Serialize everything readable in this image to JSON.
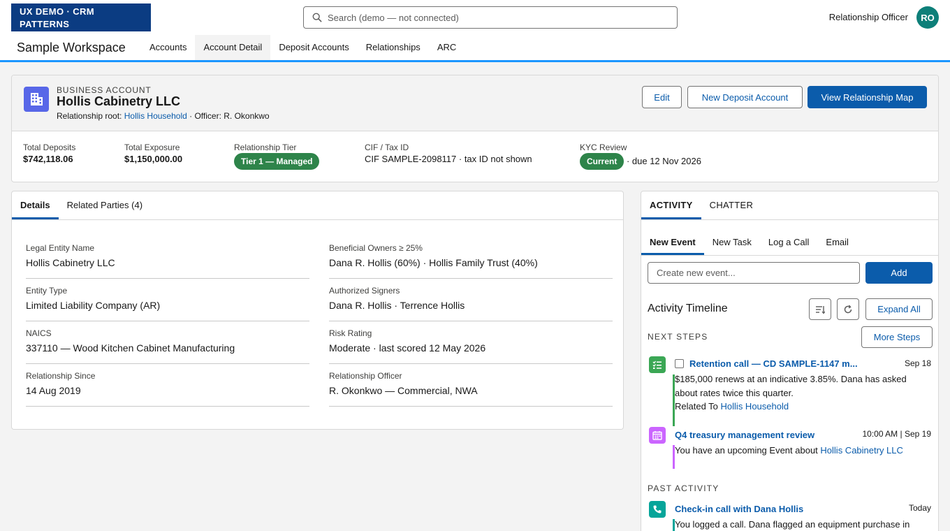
{
  "header": {
    "brand_line1": "UX DEMO · CRM",
    "brand_line2": "PATTERNS",
    "search_placeholder": "Search (demo — not connected)",
    "user_role": "Relationship Officer",
    "avatar_initials": "RO"
  },
  "nav": {
    "app_name": "Sample Workspace",
    "items": [
      {
        "label": "Accounts"
      },
      {
        "label": "Account Detail",
        "active": true
      },
      {
        "label": "Deposit Accounts"
      },
      {
        "label": "Relationships"
      },
      {
        "label": "ARC"
      }
    ]
  },
  "record": {
    "type": "BUSINESS ACCOUNT",
    "name": "Hollis Cabinetry LLC",
    "sub_prefix": "Relationship root: ",
    "sub_link": "Hollis Household",
    "sub_suffix": " · Officer: R. Okonkwo",
    "icon": "building-icon",
    "icon_color": "#5867e8",
    "actions": {
      "edit": "Edit",
      "new_deposit": "New Deposit Account",
      "view_map": "View Relationship Map"
    },
    "highlights": [
      {
        "label": "Total Deposits",
        "value": "$742,118.06"
      },
      {
        "label": "Total Exposure",
        "value": "$1,150,000.00"
      },
      {
        "label": "Relationship Tier",
        "value": "Tier 1 — Managed"
      },
      {
        "label": "CIF / Tax ID",
        "value": "CIF SAMPLE-2098117 · tax ID not shown"
      },
      {
        "label": "KYC Review",
        "value": "Current",
        "suffix": " · due 12 Nov 2026"
      }
    ],
    "status_color": "#2e844a"
  },
  "details": {
    "tabs": [
      {
        "label": "Details",
        "active": true
      },
      {
        "label": "Related Parties (4)"
      }
    ],
    "fields_left": [
      {
        "label": "Legal Entity Name",
        "value": "Hollis Cabinetry LLC"
      },
      {
        "label": "Entity Type",
        "value": "Limited Liability Company (AR)"
      },
      {
        "label": "NAICS",
        "value": "337110 — Wood Kitchen Cabinet Manufacturing"
      },
      {
        "label": "Relationship Since",
        "value": "14 Aug 2019"
      }
    ],
    "fields_right": [
      {
        "label": "Beneficial Owners ≥ 25%",
        "value": "Dana R. Hollis (60%) · Hollis Family Trust (40%)"
      },
      {
        "label": "Authorized Signers",
        "value": "Dana R. Hollis · Terrence Hollis"
      },
      {
        "label": "Risk Rating",
        "value": "Moderate · last scored 12 May 2026"
      },
      {
        "label": "Relationship Officer",
        "value": "R. Okonkwo — Commercial, NWA"
      }
    ]
  },
  "activity": {
    "tabs": [
      {
        "label": "ACTIVITY",
        "active": true
      },
      {
        "label": "CHATTER"
      }
    ],
    "sub_tabs": [
      {
        "label": "New Event",
        "active": true
      },
      {
        "label": "New Task"
      },
      {
        "label": "Log a Call"
      },
      {
        "label": "Email"
      }
    ],
    "composer_placeholder": "Create new event...",
    "add_label": "Add",
    "timeline_title": "Activity Timeline",
    "expand_all": "Expand All",
    "next_steps_label": "NEXT STEPS",
    "more_steps": "More Steps",
    "past_label": "PAST ACTIVITY",
    "items": [
      {
        "icon": "task-icon",
        "color": "#3ba755",
        "title": "Retention call — CD SAMPLE-1147 m...",
        "date": "Sep 18",
        "body": "$185,000 renews at an indicative 3.85%. Dana has asked about rates twice this quarter.",
        "related_prefix": "Related To ",
        "related_link": "Hollis Household"
      },
      {
        "icon": "calendar-icon",
        "color": "#cb65ff",
        "title": "Q4 treasury management review",
        "date": "10:00 AM | Sep 19",
        "body_prefix": "You have an upcoming Event about ",
        "body_link": "Hollis Cabinetry LLC"
      },
      {
        "icon": "phone-icon",
        "color": "#06a59a",
        "title": "Check-in call with Dana Hollis",
        "date": "Today",
        "body": "You logged a call. Dana flagged an equipment purchase in"
      }
    ]
  }
}
